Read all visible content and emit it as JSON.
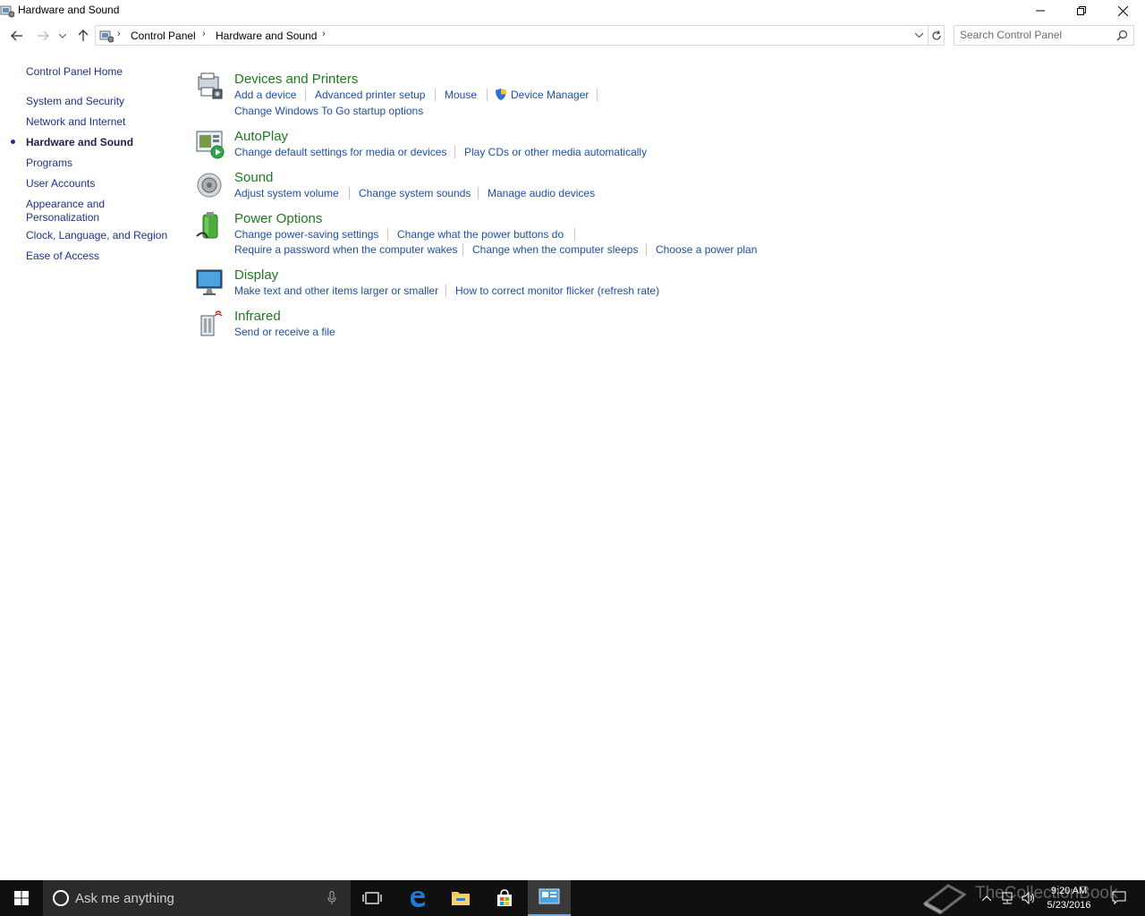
{
  "window": {
    "title": "Hardware and Sound",
    "minimize_icon": "minimize-icon",
    "restore_icon": "restore-icon",
    "close_icon": "close-icon"
  },
  "address_bar": {
    "breadcrumbs": [
      "Control Panel",
      "Hardware and Sound"
    ],
    "search_placeholder": "Search Control Panel"
  },
  "sidebar": {
    "items": [
      {
        "label": "Control Panel Home",
        "active": false
      },
      {
        "label": "System and Security",
        "active": false
      },
      {
        "label": "Network and Internet",
        "active": false
      },
      {
        "label": "Hardware and Sound",
        "active": true
      },
      {
        "label": "Programs",
        "active": false
      },
      {
        "label": "User Accounts",
        "active": false
      },
      {
        "label": "Appearance and",
        "label2": "Personalization",
        "active": false
      },
      {
        "label": "Clock, Language, and Region",
        "active": false
      },
      {
        "label": "Ease of Access",
        "active": false
      }
    ]
  },
  "categories": [
    {
      "title": "Devices and Printers",
      "icon": "printer-icon",
      "links": [
        "Add a device",
        "Advanced printer setup",
        "Mouse",
        "Device Manager",
        "Change Windows To Go startup options"
      ]
    },
    {
      "title": "AutoPlay",
      "icon": "autoplay-icon",
      "links": [
        "Change default settings for media or devices",
        "Play CDs or other media automatically"
      ]
    },
    {
      "title": "Sound",
      "icon": "speaker-icon",
      "links": [
        "Adjust system volume",
        "Change system sounds",
        "Manage audio devices"
      ]
    },
    {
      "title": "Power Options",
      "icon": "battery-icon",
      "links": [
        "Change power-saving settings",
        "Change what the power buttons do",
        "Require a password when the computer wakes",
        "Change when the computer sleeps",
        "Choose a power plan"
      ]
    },
    {
      "title": "Display",
      "icon": "monitor-icon",
      "links": [
        "Make text and other items larger or smaller",
        "How to correct monitor flicker (refresh rate)"
      ]
    },
    {
      "title": "Infrared",
      "icon": "infrared-icon",
      "links": [
        "Send or receive a file"
      ]
    }
  ],
  "taskbar": {
    "search_text": "Ask me anything",
    "time": "9:20 AM",
    "date": "5/23/2016",
    "watermark": "TheCollectionBook"
  },
  "colors": {
    "category_title": "#1e7a1e",
    "task_link": "#1e4fa5",
    "nav_link": "#1e3287",
    "taskbar_bg": "#101010"
  }
}
